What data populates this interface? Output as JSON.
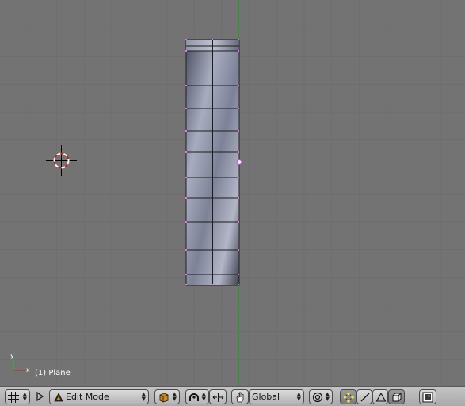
{
  "viewport": {
    "object_label": "(1) Plane",
    "axis_x": "x",
    "axis_y": "y"
  },
  "header": {
    "mode_label": "Edit Mode",
    "orientation_label": "Global",
    "icons": [
      "view-menu-icon",
      "header-triangle-icon",
      "mode-icon",
      "draw-type-icon",
      "proportional-edit-icon",
      "mirror-icon",
      "manipulator-hand-icon",
      "pivot-icon",
      "vertex-select-icon",
      "edge-select-icon",
      "face-select-icon",
      "occlude-icon",
      "render-image-icon"
    ]
  },
  "colors": {
    "background": "#737373",
    "grid": "#6a6a6a",
    "x_axis": "#9a2a2a",
    "y_axis": "#2a9a2a",
    "header": "#b9b9b9"
  }
}
